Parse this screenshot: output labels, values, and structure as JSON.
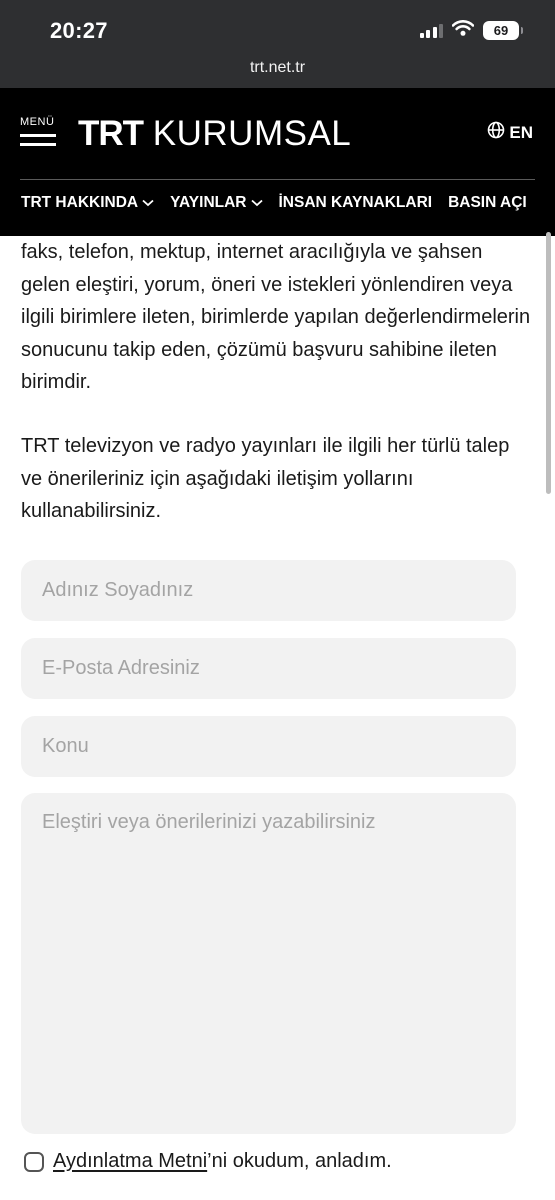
{
  "status_bar": {
    "time": "20:27",
    "battery": "69"
  },
  "browser": {
    "url": "trt.net.tr"
  },
  "header": {
    "menu_label": "MENÜ",
    "logo_bold": "TRT",
    "logo_light": "KURUMSAL",
    "language": "EN",
    "nav": [
      {
        "label": "TRT HAKKINDA",
        "has_dropdown": true
      },
      {
        "label": "YAYINLAR",
        "has_dropdown": true
      },
      {
        "label": "İNSAN KAYNAKLARI",
        "has_dropdown": false
      },
      {
        "label": "BASIN AÇI",
        "has_dropdown": false
      }
    ]
  },
  "content": {
    "paragraphs": [
      "faks, telefon, mektup, internet aracılığıyla ve şahsen gelen eleştiri, yorum, öneri ve istekleri yönlendiren veya ilgili birimlere ileten, birimlerde yapılan değerlendirmelerin sonucunu takip eden, çözümü başvuru sahibine ileten birimdir.",
      "TRT televizyon ve radyo yayınları ile ilgili her türlü talep ve önerileriniz için aşağıdaki iletişim yollarını kullanabilirsiniz."
    ]
  },
  "form": {
    "name_placeholder": "Adınız Soyadınız",
    "email_placeholder": "E-Posta Adresiniz",
    "subject_placeholder": "Konu",
    "message_placeholder": "Eleştiri veya önerilerinizi yazabilirsiniz",
    "consent_link": "Aydınlatma Metni",
    "consent_text": "’ni okudum, anladım."
  }
}
